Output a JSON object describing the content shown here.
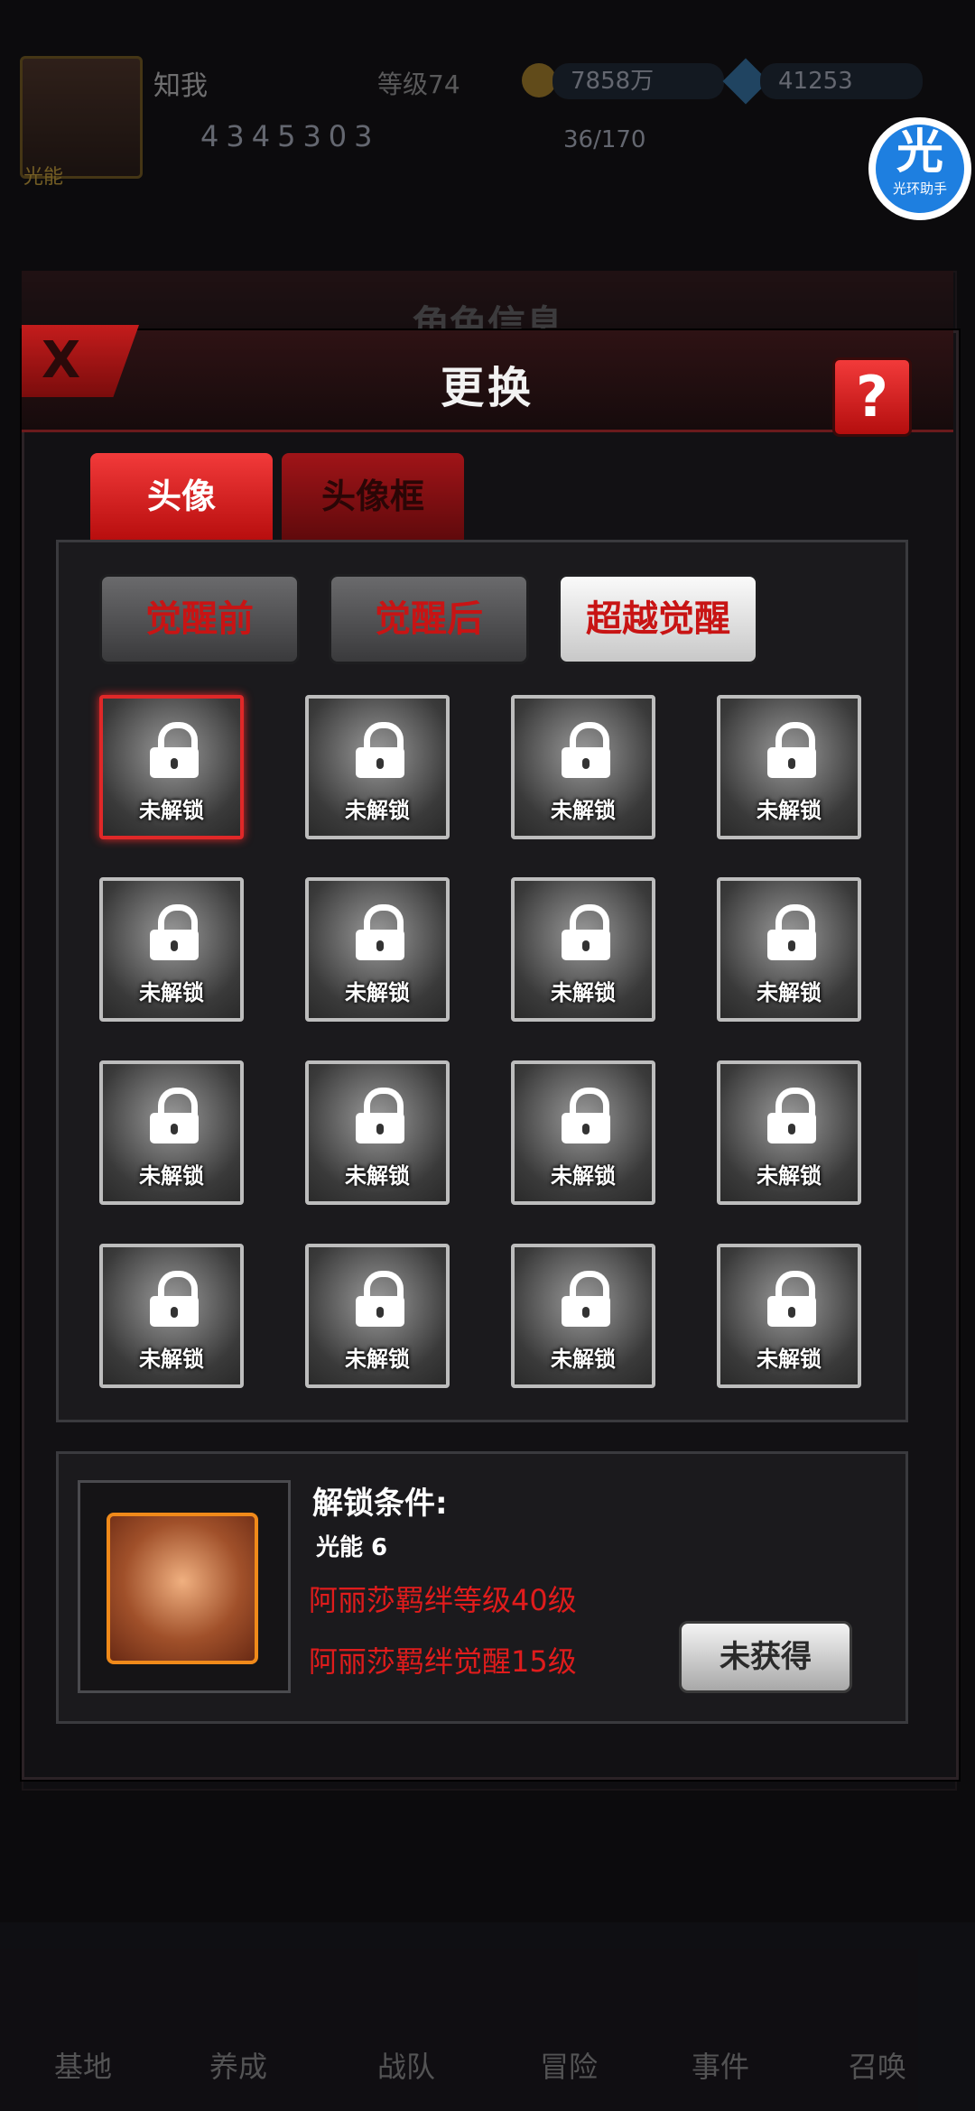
{
  "background": {
    "player_name": "知我",
    "player_level": "等级74",
    "coins": "7858万",
    "gems": "41253",
    "power": "4345303",
    "stamina": "36/170",
    "energy_badge": "光能",
    "panel_title": "角色信息",
    "nav_labels": [
      "基地",
      "养成",
      "战队",
      "冒险",
      "事件",
      "召唤"
    ]
  },
  "helper": {
    "glyph": "光",
    "label": "光环助手"
  },
  "modal": {
    "close_label": "X",
    "title": "更换",
    "help_label": "?"
  },
  "tabs": [
    {
      "label": "头像",
      "active": true
    },
    {
      "label": "头像框",
      "active": false
    }
  ],
  "subtabs": [
    {
      "label": "觉醒前",
      "active": false
    },
    {
      "label": "觉醒后",
      "active": false
    },
    {
      "label": "超越觉醒",
      "active": true
    }
  ],
  "avatars": [
    {
      "label": "未解锁",
      "selected": true
    },
    {
      "label": "未解锁",
      "selected": false
    },
    {
      "label": "未解锁",
      "selected": false
    },
    {
      "label": "未解锁",
      "selected": false
    },
    {
      "label": "未解锁",
      "selected": false
    },
    {
      "label": "未解锁",
      "selected": false
    },
    {
      "label": "未解锁",
      "selected": false
    },
    {
      "label": "未解锁",
      "selected": false
    },
    {
      "label": "未解锁",
      "selected": false
    },
    {
      "label": "未解锁",
      "selected": false
    },
    {
      "label": "未解锁",
      "selected": false
    },
    {
      "label": "未解锁",
      "selected": false
    },
    {
      "label": "未解锁",
      "selected": false
    },
    {
      "label": "未解锁",
      "selected": false
    },
    {
      "label": "未解锁",
      "selected": false
    },
    {
      "label": "未解锁",
      "selected": false
    }
  ],
  "unlock": {
    "title": "解锁条件:",
    "energy": "光能 6",
    "conditions": [
      "阿丽莎羁绊等级40级",
      "阿丽莎羁绊觉醒15级"
    ],
    "button_label": "未获得"
  },
  "colors": {
    "accent_red": "#e01c1c",
    "panel_bg": "#1b1a1d"
  }
}
